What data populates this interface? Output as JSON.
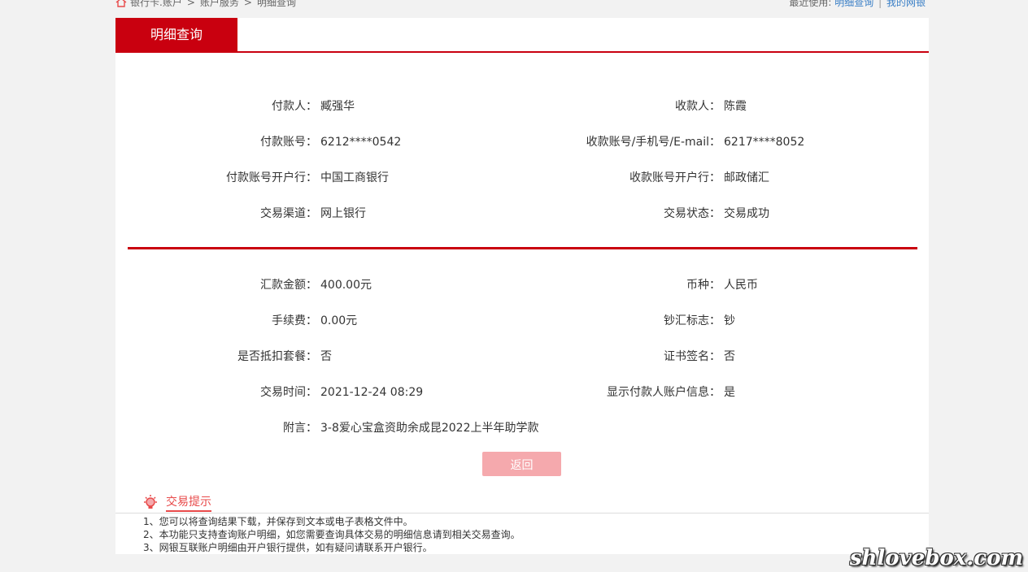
{
  "breadcrumb": {
    "items": [
      "银行卡.账户",
      "账户服务",
      "明细查询"
    ],
    "separator": ">"
  },
  "recent": {
    "label": "最近使用:",
    "links": [
      "明细查询",
      "我的网银"
    ],
    "divider": "|"
  },
  "tab": {
    "label": "明细查询"
  },
  "section1": {
    "left": [
      {
        "label": "付款人：",
        "value": "臧强华"
      },
      {
        "label": "付款账号：",
        "value": "6212****0542"
      },
      {
        "label": "付款账号开户行：",
        "value": "中国工商银行"
      },
      {
        "label": "交易渠道：",
        "value": "网上银行"
      }
    ],
    "right": [
      {
        "label": "收款人：",
        "value": "陈霞"
      },
      {
        "label": "收款账号/手机号/E-mail：",
        "value": "6217****8052"
      },
      {
        "label": "收款账号开户行：",
        "value": "邮政储汇"
      },
      {
        "label": "交易状态：",
        "value": "交易成功"
      }
    ]
  },
  "section2": {
    "left": [
      {
        "label": "汇款金额：",
        "value": "400.00元"
      },
      {
        "label": "手续费：",
        "value": "0.00元"
      },
      {
        "label": "是否抵扣套餐：",
        "value": "否"
      },
      {
        "label": "交易时间：",
        "value": "2021-12-24 08:29"
      },
      {
        "label": "附言：",
        "value": "3-8爱心宝盒资助余成昆2022上半年助学款"
      }
    ],
    "right": [
      {
        "label": "币种：",
        "value": "人民币"
      },
      {
        "label": "钞汇标志：",
        "value": "钞"
      },
      {
        "label": "证书签名：",
        "value": "否"
      },
      {
        "label": "显示付款人账户信息：",
        "value": "是"
      }
    ]
  },
  "buttons": {
    "back": "返回"
  },
  "tips": {
    "title": "交易提示",
    "items": [
      "1、您可以将查询结果下载，并保存到文本或电子表格文件中。",
      "2、本功能只支持查询账户明细，如您需要查询具体交易的明细信息请到相关交易查询。",
      "3、网银互联账户明细由开户银行提供，如有疑问请联系开户银行。"
    ]
  },
  "watermark": "shlovebox.com",
  "colors": {
    "accent": "#c9000f",
    "button": "#f5a9ad",
    "link": "#3a7fc6",
    "tip": "#e84a4a"
  }
}
